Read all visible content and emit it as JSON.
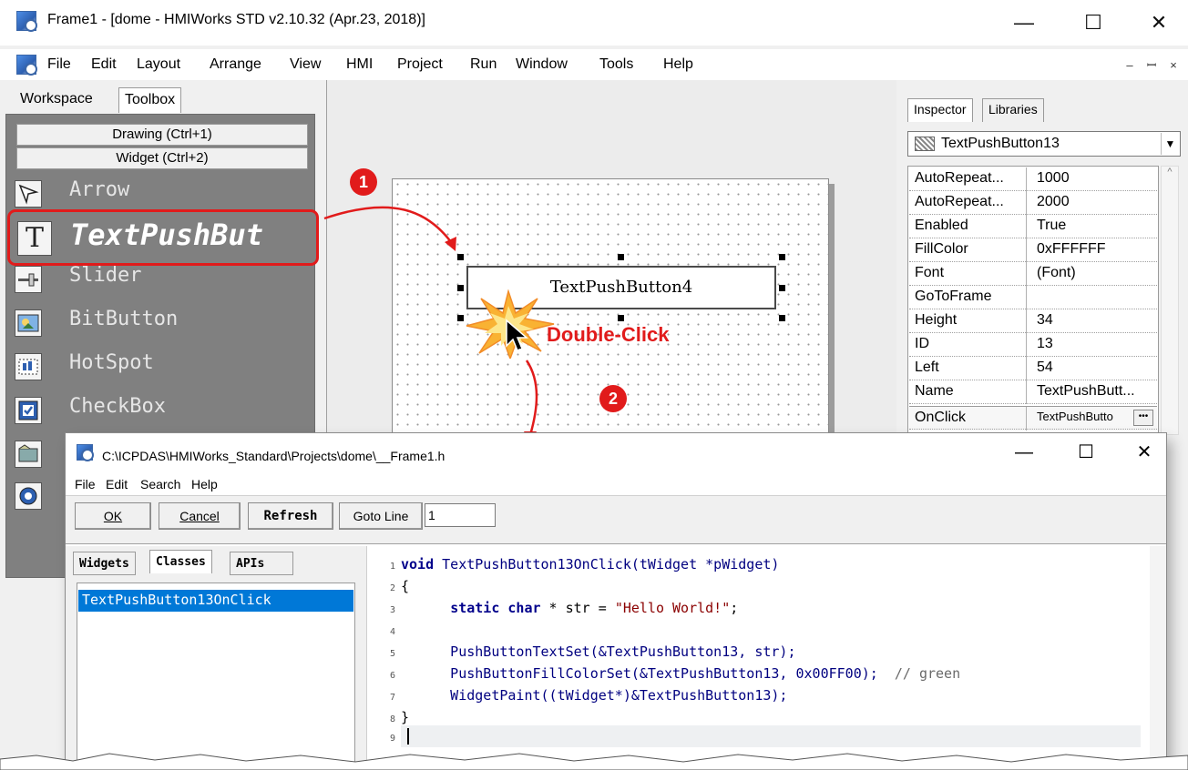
{
  "main": {
    "title": "Frame1 - [dome - HMIWorks STD v2.10.32 (Apr.23, 2018)]",
    "caption_buttons": {
      "minimize": "—",
      "maximize": "☐",
      "close": "✕"
    },
    "menu": [
      "File",
      "Edit",
      "Layout",
      "Arrange",
      "View",
      "HMI",
      "Project",
      "Run",
      "Window",
      "Tools",
      "Help"
    ],
    "mdi_buttons": {
      "minimize": "–",
      "restore": "ꟷ",
      "close": "×"
    }
  },
  "left_panel": {
    "tabs": [
      "Workspace",
      "Toolbox"
    ],
    "categories": [
      "Drawing (Ctrl+1)",
      "Widget (Ctrl+2)"
    ],
    "tools": [
      {
        "label": "Arrow",
        "icon": "arrow-icon"
      },
      {
        "label": "TextPushBut",
        "icon": "text-icon"
      },
      {
        "label": "Slider",
        "icon": "slider-icon"
      },
      {
        "label": "BitButton",
        "icon": "bitbutton-icon"
      },
      {
        "label": "HotSpot",
        "icon": "hotspot-icon"
      },
      {
        "label": "CheckBox",
        "icon": "checkbox-icon"
      }
    ]
  },
  "canvas": {
    "widget_text": "TextPushButton4"
  },
  "annotations": {
    "step1": "1",
    "step2": "2",
    "double_click": "Double-Click",
    "accent_color": "#e11b1b"
  },
  "inspector": {
    "tabs": [
      "Inspector",
      "Libraries"
    ],
    "selected_object": "TextPushButton13",
    "properties": [
      {
        "name": "AutoRepeat...",
        "value": "1000"
      },
      {
        "name": "AutoRepeat...",
        "value": "2000"
      },
      {
        "name": "Enabled",
        "value": "True"
      },
      {
        "name": "FillColor",
        "value": "0xFFFFFF"
      },
      {
        "name": "Font",
        "value": "(Font)"
      },
      {
        "name": "GoToFrame",
        "value": ""
      },
      {
        "name": "Height",
        "value": "34"
      },
      {
        "name": "ID",
        "value": "13"
      },
      {
        "name": "Left",
        "value": "54"
      },
      {
        "name": "Name",
        "value": "TextPushButt..."
      },
      {
        "name": "OnClick",
        "value": "TextPushButto"
      }
    ]
  },
  "editor": {
    "title": "C:\\ICPDAS\\HMIWorks_Standard\\Projects\\dome\\__Frame1.h",
    "menu": [
      "File",
      "Edit",
      "Search",
      "Help"
    ],
    "buttons": {
      "ok": "OK",
      "cancel": "Cancel",
      "refresh": "Refresh",
      "goto_line": "Goto Line"
    },
    "goto_line_value": "1",
    "side_tabs": [
      "Widgets",
      "Classes",
      "APIs"
    ],
    "side_items": [
      "TextPushButton13OnClick"
    ],
    "selection_color": "#0078d7"
  },
  "code": {
    "line_numbers": [
      "1",
      "2",
      "3",
      "4",
      "5",
      "6",
      "7",
      "8",
      "9"
    ],
    "l1_kw": "void",
    "l1_rest": " TextPushButton13OnClick(tWidget *pWidget)",
    "l2": "{",
    "l3_indent": "      ",
    "l3_kw1": "static",
    "l3_sp": " ",
    "l3_kw2": "char",
    "l3_mid": " * str = ",
    "l3_str": "\"Hello World!\"",
    "l3_end": ";",
    "l5": "      PushButtonTextSet(&TextPushButton13, str);",
    "l6_code": "      PushButtonFillColorSet(&TextPushButton13, 0x00FF00);",
    "l6_comment": "  // green",
    "l7": "      WidgetPaint((tWidget*)&TextPushButton13);",
    "l8": "}"
  }
}
